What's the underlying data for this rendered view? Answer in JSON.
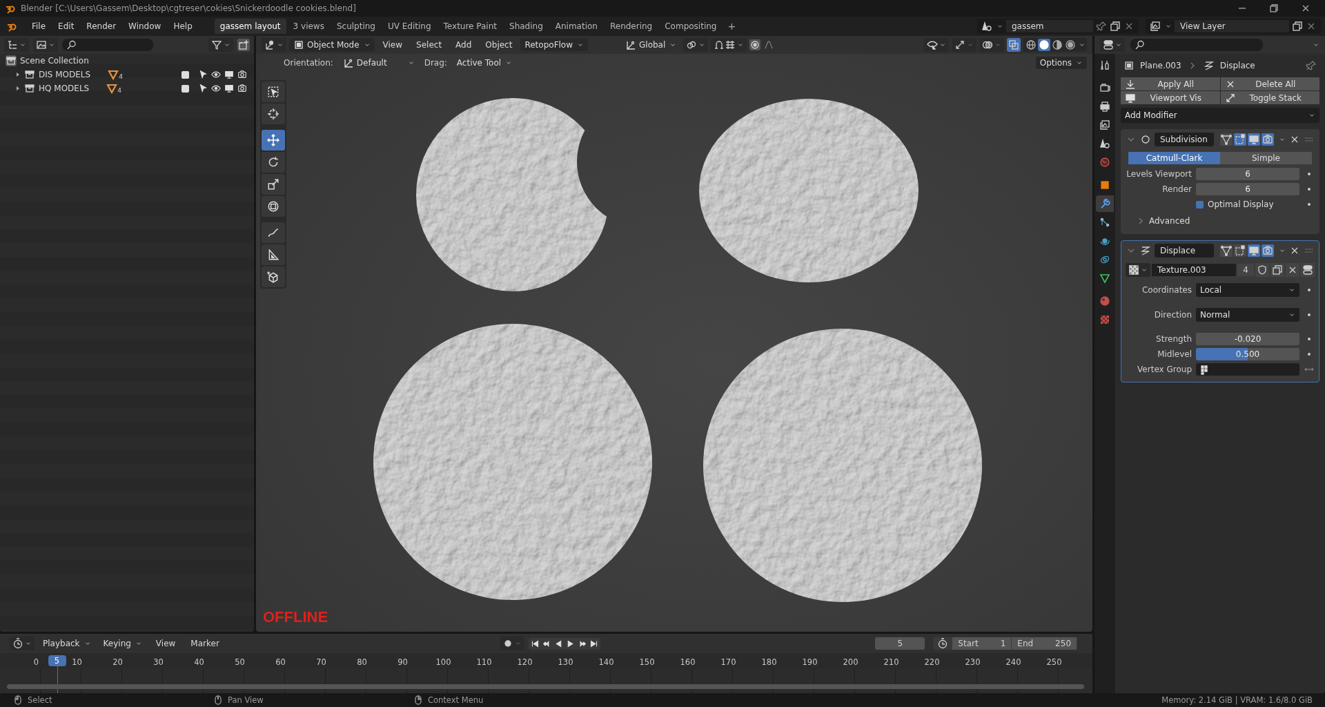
{
  "title_bar": {
    "title": "Blender [C:\\Users\\Gassem\\Desktop\\cgtreser\\cokies\\Snickerdoodle cookies.blend]"
  },
  "menu": [
    "File",
    "Edit",
    "Render",
    "Window",
    "Help"
  ],
  "workspaces": [
    {
      "label": "gassem layout",
      "selected": true
    },
    {
      "label": "3 views",
      "selected": false
    },
    {
      "label": "Sculpting",
      "selected": false
    },
    {
      "label": "UV Editing",
      "selected": false
    },
    {
      "label": "Texture Paint",
      "selected": false
    },
    {
      "label": "Shading",
      "selected": false
    },
    {
      "label": "Animation",
      "selected": false
    },
    {
      "label": "Rendering",
      "selected": false
    },
    {
      "label": "Compositing",
      "selected": false
    }
  ],
  "add_workspace": "+",
  "scene": {
    "name": "gassem"
  },
  "view_layer": {
    "name": "View Layer"
  },
  "outliner": {
    "items": [
      {
        "name": "Scene Collection",
        "children": [
          {
            "name": "DIS MODELS",
            "expanded": false,
            "count": "4",
            "enabled": true
          },
          {
            "name": "HQ MODELS",
            "expanded": false,
            "count": "4",
            "enabled": true
          }
        ]
      }
    ]
  },
  "viewport": {
    "mode": "Object Mode",
    "menus": [
      "View",
      "Select",
      "Add",
      "Object"
    ],
    "addon_menu": "RetopoFlow",
    "transform_orientation": "Global",
    "orientation_label": "Orientation:",
    "orientation": "Default",
    "drag_label": "Drag:",
    "drag": "Active Tool",
    "options": "Options",
    "xray": true,
    "shading": [
      {
        "kind": "wireframe",
        "selected": false
      },
      {
        "kind": "solid",
        "selected": true
      },
      {
        "kind": "material",
        "selected": false
      },
      {
        "kind": "rendered",
        "selected": false
      }
    ],
    "tools": [
      {
        "kind": "select",
        "selected": false
      },
      {
        "kind": "cursor",
        "selected": false
      },
      {
        "kind": "move",
        "selected": true
      },
      {
        "kind": "rotate",
        "selected": false
      },
      {
        "kind": "scale",
        "selected": false
      },
      {
        "kind": "transform",
        "selected": false
      },
      {
        "kind": "annotate",
        "selected": false
      },
      {
        "kind": "measure",
        "selected": false
      },
      {
        "kind": "add",
        "selected": false
      }
    ],
    "status_text": "OFFLINE"
  },
  "properties": {
    "object": "Plane.003",
    "modifier": "Displace",
    "tabs": [
      {
        "kind": "tool",
        "selected": false
      },
      {
        "kind": "render",
        "selected": false
      },
      {
        "kind": "output",
        "selected": false
      },
      {
        "kind": "view_layer",
        "selected": false
      },
      {
        "kind": "scene",
        "selected": false
      },
      {
        "kind": "world",
        "selected": false
      },
      {
        "kind": "object",
        "selected": false
      },
      {
        "kind": "modifiers",
        "selected": true
      },
      {
        "kind": "particles",
        "selected": false
      },
      {
        "kind": "physics",
        "selected": false
      },
      {
        "kind": "constraints",
        "selected": false
      },
      {
        "kind": "data",
        "selected": false
      },
      {
        "kind": "material",
        "selected": false
      },
      {
        "kind": "texture",
        "selected": false
      }
    ],
    "actions": [
      {
        "kind": "apply",
        "label": "Apply All"
      },
      {
        "kind": "delete",
        "label": "Delete All"
      },
      {
        "kind": "viewport",
        "label": "Viewport Vis"
      },
      {
        "kind": "toggle",
        "label": "Toggle Stack"
      }
    ],
    "add_modifier": "Add Modifier",
    "modifiers": [
      {
        "kind": "subdivision",
        "name": "Subdivision",
        "expanded": true,
        "active": false,
        "editmode": true,
        "viewport": true,
        "render": true,
        "fields": [
          {
            "kind": "segmented",
            "options": [
              {
                "label": "Catmull-Clark",
                "selected": true
              },
              {
                "label": "Simple",
                "selected": false
              }
            ]
          },
          {
            "kind": "number",
            "label": "Levels Viewport",
            "value": "6"
          },
          {
            "kind": "number",
            "label": "Render",
            "value": "6"
          },
          {
            "kind": "checkbox",
            "label": "Optimal Display",
            "checked": true
          },
          {
            "kind": "subpanel",
            "label": "Advanced",
            "expanded": false
          }
        ]
      },
      {
        "kind": "displace",
        "name": "Displace",
        "expanded": true,
        "active": true,
        "editmode": false,
        "viewport": true,
        "render": true,
        "fields": [
          {
            "kind": "texture",
            "name": "Texture.003",
            "users": "4"
          },
          {
            "kind": "dropdown",
            "label": "Coordinates",
            "value": "Local"
          },
          {
            "kind": "dropdown",
            "label": "Direction",
            "value": "Normal"
          },
          {
            "kind": "number",
            "label": "Strength",
            "value": "-0.020"
          },
          {
            "kind": "slider",
            "label": "Midlevel",
            "value": "0.500",
            "level": 0.5
          },
          {
            "kind": "vertex_group",
            "label": "Vertex Group"
          }
        ]
      }
    ]
  },
  "timeline": {
    "menus": [
      "Playback",
      "Keying"
    ],
    "plain_menus": [
      "View",
      "Marker"
    ],
    "current_frame": "5",
    "marker_frame": "5",
    "start_label": "Start",
    "start": "1",
    "end_label": "End",
    "end": "250",
    "ticks": [
      "0",
      "10",
      "20",
      "30",
      "40",
      "50",
      "60",
      "70",
      "80",
      "90",
      "100",
      "110",
      "120",
      "130",
      "140",
      "150",
      "160",
      "170",
      "180",
      "190",
      "200",
      "210",
      "220",
      "230",
      "240",
      "250"
    ]
  },
  "status_bar": {
    "hints": [
      "Select",
      "Pan View",
      "Context Menu"
    ],
    "memory": "Memory: 2.14 GiB | VRAM: 1.6/8.0 GiB"
  }
}
